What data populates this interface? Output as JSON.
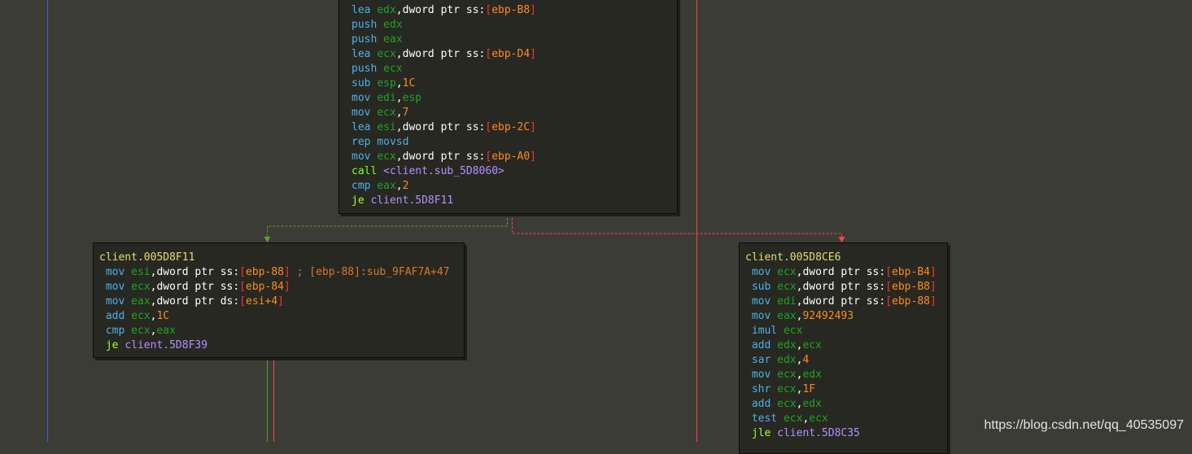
{
  "blocks": [
    {
      "id": "top",
      "lines": [
        [
          [
            "lea ",
            "mn"
          ],
          [
            "edx",
            "reg"
          ],
          [
            ",",
            "txt"
          ],
          [
            "dword ptr ss:",
            "txt"
          ],
          [
            "[",
            "brk"
          ],
          [
            "ebp-B8",
            "imm"
          ],
          [
            "]",
            "brk"
          ]
        ],
        [
          [
            "push ",
            "mn"
          ],
          [
            "edx",
            "reg"
          ]
        ],
        [
          [
            "push ",
            "mn"
          ],
          [
            "eax",
            "reg"
          ]
        ],
        [
          [
            "lea ",
            "mn"
          ],
          [
            "ecx",
            "reg"
          ],
          [
            ",",
            "txt"
          ],
          [
            "dword ptr ss:",
            "txt"
          ],
          [
            "[",
            "brk"
          ],
          [
            "ebp-D4",
            "imm"
          ],
          [
            "]",
            "brk"
          ]
        ],
        [
          [
            "push ",
            "mn"
          ],
          [
            "ecx",
            "reg"
          ]
        ],
        [
          [
            "sub ",
            "mn"
          ],
          [
            "esp",
            "reg"
          ],
          [
            ",",
            "txt"
          ],
          [
            "1C",
            "imm"
          ]
        ],
        [
          [
            "mov ",
            "mn"
          ],
          [
            "edi",
            "reg"
          ],
          [
            ",",
            "txt"
          ],
          [
            "esp",
            "reg"
          ]
        ],
        [
          [
            "mov ",
            "mn"
          ],
          [
            "ecx",
            "reg"
          ],
          [
            ",",
            "txt"
          ],
          [
            "7",
            "imm"
          ]
        ],
        [
          [
            "lea ",
            "mn"
          ],
          [
            "esi",
            "reg"
          ],
          [
            ",",
            "txt"
          ],
          [
            "dword ptr ss:",
            "txt"
          ],
          [
            "[",
            "brk"
          ],
          [
            "ebp-2C",
            "imm"
          ],
          [
            "]",
            "brk"
          ]
        ],
        [
          [
            "rep movsd",
            "mn"
          ]
        ],
        [
          [
            "mov ",
            "mn"
          ],
          [
            "ecx",
            "reg"
          ],
          [
            ",",
            "txt"
          ],
          [
            "dword ptr ss:",
            "txt"
          ],
          [
            "[",
            "brk"
          ],
          [
            "ebp-A0",
            "imm"
          ],
          [
            "]",
            "brk"
          ]
        ],
        [
          [
            "call ",
            "call"
          ],
          [
            "<client.sub_5D8060>",
            "tgt"
          ]
        ],
        [
          [
            "cmp ",
            "mn"
          ],
          [
            "eax",
            "reg"
          ],
          [
            ",",
            "txt"
          ],
          [
            "2",
            "imm"
          ]
        ],
        [
          [
            "je ",
            "jmp"
          ],
          [
            "client.5D8F11",
            "tgt"
          ]
        ]
      ]
    },
    {
      "id": "left",
      "lines": [
        [
          [
            "client.005D8F11",
            "hdr"
          ]
        ],
        [
          [
            " mov ",
            "mn"
          ],
          [
            "esi",
            "reg"
          ],
          [
            ",",
            "txt"
          ],
          [
            "dword ptr ss:",
            "txt"
          ],
          [
            "[",
            "brk"
          ],
          [
            "ebp-88",
            "imm"
          ],
          [
            "]",
            "brk"
          ],
          [
            " ; [ebp-88]:sub_9FAF7A+47",
            "cmt"
          ]
        ],
        [
          [
            " mov ",
            "mn"
          ],
          [
            "ecx",
            "reg"
          ],
          [
            ",",
            "txt"
          ],
          [
            "dword ptr ss:",
            "txt"
          ],
          [
            "[",
            "brk"
          ],
          [
            "ebp-84",
            "imm"
          ],
          [
            "]",
            "brk"
          ]
        ],
        [
          [
            " mov ",
            "mn"
          ],
          [
            "eax",
            "reg"
          ],
          [
            ",",
            "txt"
          ],
          [
            "dword ptr ds:",
            "txt"
          ],
          [
            "[",
            "brk"
          ],
          [
            "esi+4",
            "imm"
          ],
          [
            "]",
            "brk"
          ]
        ],
        [
          [
            " add ",
            "mn"
          ],
          [
            "ecx",
            "reg"
          ],
          [
            ",",
            "txt"
          ],
          [
            "1C",
            "imm"
          ]
        ],
        [
          [
            " cmp ",
            "mn"
          ],
          [
            "ecx",
            "reg"
          ],
          [
            ",",
            "txt"
          ],
          [
            "eax",
            "reg"
          ]
        ],
        [
          [
            " je ",
            "jmp"
          ],
          [
            "client.5D8F39",
            "tgt"
          ]
        ]
      ]
    },
    {
      "id": "right",
      "lines": [
        [
          [
            "client.005D8CE6",
            "hdr"
          ]
        ],
        [
          [
            " mov ",
            "mn"
          ],
          [
            "ecx",
            "reg"
          ],
          [
            ",",
            "txt"
          ],
          [
            "dword ptr ss:",
            "txt"
          ],
          [
            "[",
            "brk"
          ],
          [
            "ebp-B4",
            "imm"
          ],
          [
            "]",
            "brk"
          ]
        ],
        [
          [
            " sub ",
            "mn"
          ],
          [
            "ecx",
            "reg"
          ],
          [
            ",",
            "txt"
          ],
          [
            "dword ptr ss:",
            "txt"
          ],
          [
            "[",
            "brk"
          ],
          [
            "ebp-B8",
            "imm"
          ],
          [
            "]",
            "brk"
          ]
        ],
        [
          [
            " mov ",
            "mn"
          ],
          [
            "edi",
            "reg"
          ],
          [
            ",",
            "txt"
          ],
          [
            "dword ptr ss:",
            "txt"
          ],
          [
            "[",
            "brk"
          ],
          [
            "ebp-88",
            "imm"
          ],
          [
            "]",
            "brk"
          ]
        ],
        [
          [
            " mov ",
            "mn"
          ],
          [
            "eax",
            "reg"
          ],
          [
            ",",
            "txt"
          ],
          [
            "92492493",
            "imm"
          ]
        ],
        [
          [
            " imul ",
            "mn"
          ],
          [
            "ecx",
            "reg"
          ]
        ],
        [
          [
            " add ",
            "mn"
          ],
          [
            "edx",
            "reg"
          ],
          [
            ",",
            "txt"
          ],
          [
            "ecx",
            "reg"
          ]
        ],
        [
          [
            " sar ",
            "mn"
          ],
          [
            "edx",
            "reg"
          ],
          [
            ",",
            "txt"
          ],
          [
            "4",
            "imm"
          ]
        ],
        [
          [
            " mov ",
            "mn"
          ],
          [
            "ecx",
            "reg"
          ],
          [
            ",",
            "txt"
          ],
          [
            "edx",
            "reg"
          ]
        ],
        [
          [
            " shr ",
            "mn"
          ],
          [
            "ecx",
            "reg"
          ],
          [
            ",",
            "txt"
          ],
          [
            "1F",
            "imm"
          ]
        ],
        [
          [
            " add ",
            "mn"
          ],
          [
            "ecx",
            "reg"
          ],
          [
            ",",
            "txt"
          ],
          [
            "edx",
            "reg"
          ]
        ],
        [
          [
            " test ",
            "mn"
          ],
          [
            "ecx",
            "reg"
          ],
          [
            ",",
            "txt"
          ],
          [
            "ecx",
            "reg"
          ]
        ],
        [
          [
            " jle ",
            "jmp"
          ],
          [
            "client.5D8C35",
            "tgt"
          ]
        ]
      ]
    }
  ],
  "colors": {
    "background": "#3c3c37",
    "block_bg": "#272822",
    "edge_true": "#5aa02c",
    "edge_false": "#ff4444",
    "edge_back": "#3b5bd6"
  },
  "watermark": "https://blog.csdn.net/qq_40535097"
}
